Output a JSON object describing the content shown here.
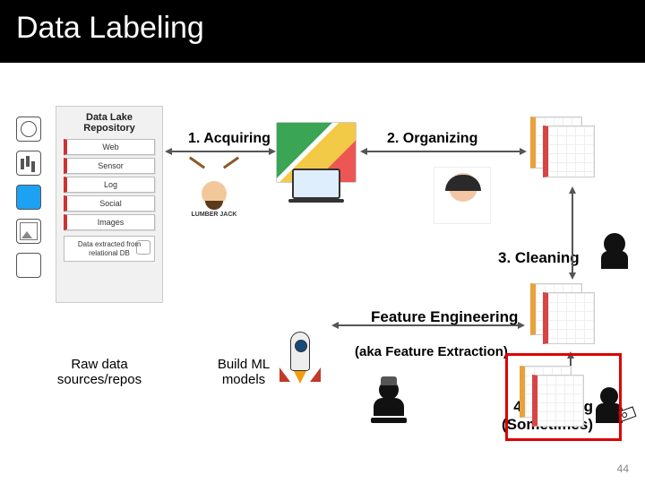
{
  "title": "Data Labeling",
  "steps": {
    "s1": "1. Acquiring",
    "s2": "2. Organizing",
    "s3": "3. Cleaning",
    "s4_a": "4. Labeling",
    "s4_b": "(Sometimes)"
  },
  "feature": {
    "line1": "Feature Engineering",
    "line2": "(aka Feature Extraction)"
  },
  "raw": {
    "line1": "Raw data",
    "line2": "sources/repos"
  },
  "build": {
    "line1": "Build ML",
    "line2": "models"
  },
  "repo": {
    "title": "Data Lake Repository",
    "items": [
      "Web",
      "Sensor",
      "Log",
      "Social",
      "Images"
    ],
    "db": "Data extracted from relational DB"
  },
  "lumberjack": "LUMBER JACK",
  "page_number": "44"
}
